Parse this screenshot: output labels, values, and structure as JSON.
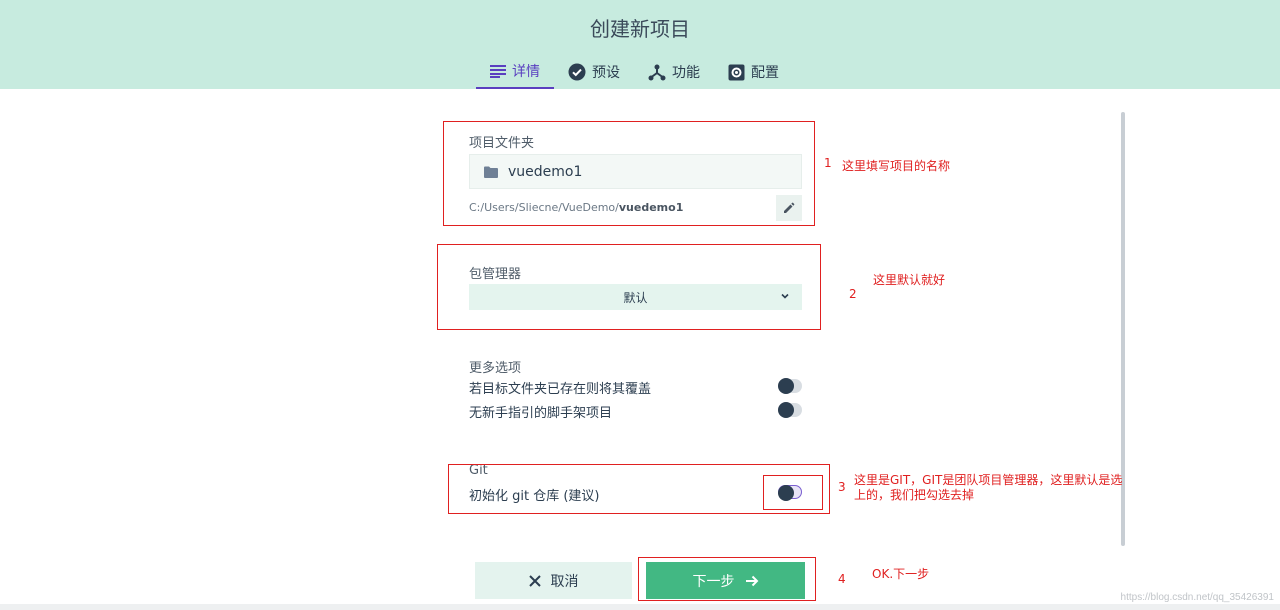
{
  "header": {
    "title": "创建新项目",
    "tabs": [
      {
        "label": "详情",
        "icon": "details-icon",
        "active": true
      },
      {
        "label": "预设",
        "icon": "check-circle-icon",
        "active": false
      },
      {
        "label": "功能",
        "icon": "fork-icon",
        "active": false
      },
      {
        "label": "配置",
        "icon": "gear-icon",
        "active": false
      }
    ]
  },
  "details": {
    "folder_label": "项目文件夹",
    "folder_value": "vuedemo1",
    "path_prefix": "C:/Users/Sliecne/VueDemo/",
    "path_name": "vuedemo1",
    "package_manager_label": "包管理器",
    "package_manager_value": "默认",
    "more_options_label": "更多选项",
    "options": [
      {
        "label": "若目标文件夹已存在则将其覆盖",
        "checked": false
      },
      {
        "label": "无新手指引的脚手架项目",
        "checked": false
      }
    ],
    "git_label": "Git",
    "git_init_label": "初始化 git 仓库 (建议)",
    "git_init_checked": false
  },
  "actions": {
    "cancel_label": "取消",
    "next_label": "下一步"
  },
  "annotations": {
    "a1_num": "1",
    "a1_text": "这里填写项目的名称",
    "a2_num": "2",
    "a2_text": "这里默认就好",
    "a3_num": "3",
    "a3_text_line1": "这里是GIT，GIT是团队项目管理器，这里默认是选",
    "a3_text_line2": "上的，我们把勾选去掉",
    "a4_num": "4",
    "a4_text": "OK.下一步"
  },
  "watermark": "https://blog.csdn.net/qq_35426391",
  "colors": {
    "header_bg": "#c7ebdf",
    "accent": "#5a3fc0",
    "primary_button": "#42b883",
    "annotation_red": "#e02020"
  }
}
